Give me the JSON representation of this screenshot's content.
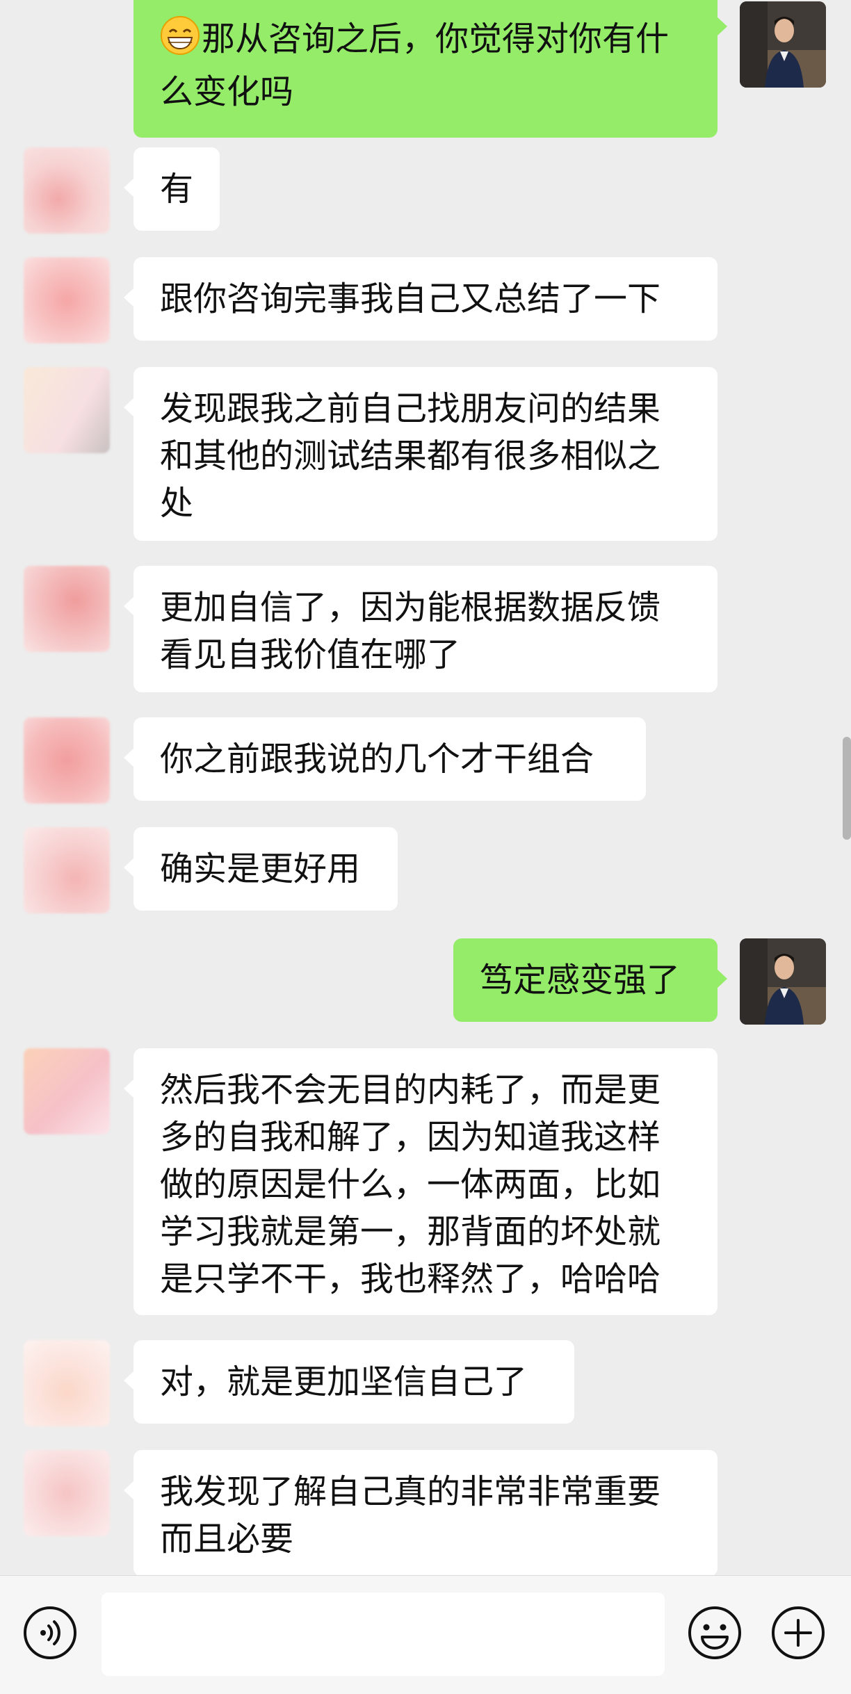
{
  "conversation": [
    {
      "side": "right",
      "emoji": "grinning-face",
      "text": "那从咨询之后，你觉得对你有什么变化吗"
    },
    {
      "side": "left",
      "text": "有"
    },
    {
      "side": "left",
      "text": "跟你咨询完事我自己又总结了一下"
    },
    {
      "side": "left",
      "text": "发现跟我之前自己找朋友问的结果和其他的测试结果都有很多相似之处"
    },
    {
      "side": "left",
      "text": "更加自信了，因为能根据数据反馈看见自我价值在哪了"
    },
    {
      "side": "left",
      "text": "你之前跟我说的几个才干组合"
    },
    {
      "side": "left",
      "text": "确实是更好用"
    },
    {
      "side": "right",
      "text": "笃定感变强了"
    },
    {
      "side": "left",
      "text": "然后我不会无目的内耗了，而是更多的自我和解了，因为知道我这样做的原因是什么，一体两面，比如学习我就是第一，那背面的坏处就是只学不干，我也释然了，哈哈哈"
    },
    {
      "side": "left",
      "text": "对，就是更加坚信自己了"
    },
    {
      "side": "left",
      "text": "我发现了解自己真的非常非常重要而且必要"
    }
  ],
  "input_bar": {
    "voice_icon": "voice-icon",
    "text_value": "",
    "emoji_icon": "emoji-icon",
    "plus_icon": "plus-icon"
  },
  "colors": {
    "background": "#ededed",
    "sent_bubble": "#95ec69",
    "received_bubble": "#ffffff"
  }
}
